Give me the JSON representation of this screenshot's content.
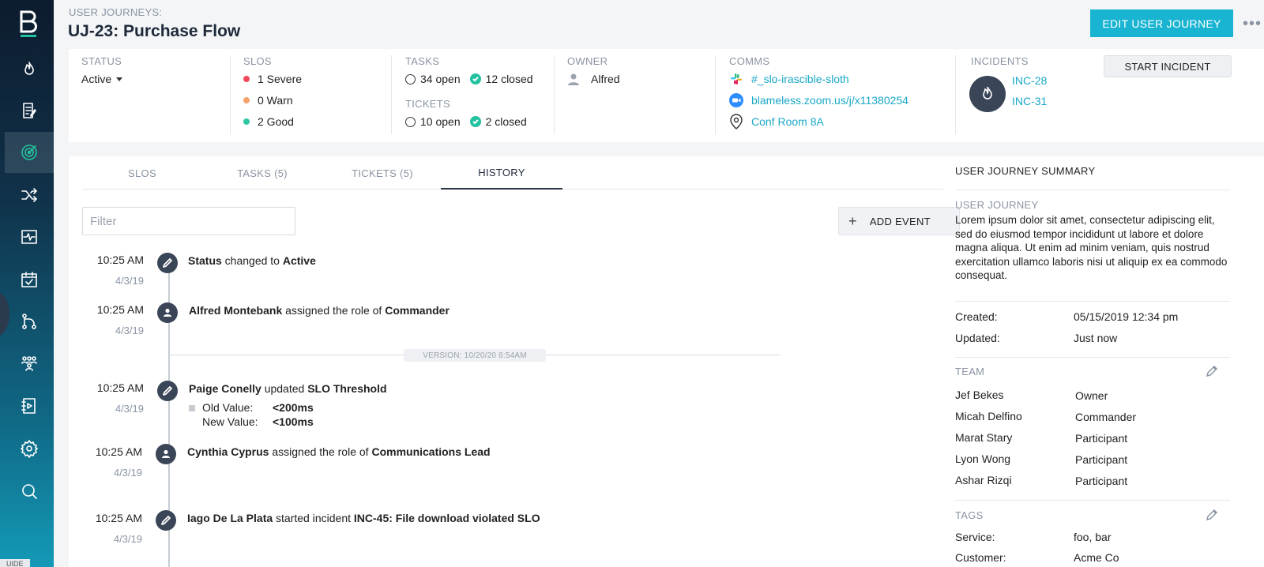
{
  "sidebar": {
    "logo": "B",
    "items": [
      {
        "icon": "flame-icon"
      },
      {
        "icon": "document-edit-icon"
      },
      {
        "icon": "target-icon",
        "active": true
      },
      {
        "icon": "shuffle-icon"
      },
      {
        "icon": "pulse-icon"
      },
      {
        "icon": "calendar-check-icon"
      },
      {
        "icon": "git-branch-icon"
      },
      {
        "icon": "team-icon"
      },
      {
        "icon": "playbook-icon"
      },
      {
        "icon": "gear-icon"
      },
      {
        "icon": "search-icon"
      }
    ],
    "bottom_tag": "UIDE"
  },
  "header": {
    "breadcrumb": "USER JOURNEYS:",
    "title": "UJ-23: Purchase Flow",
    "edit_button": "EDIT USER JOURNEY",
    "more": "•••"
  },
  "info": {
    "status": {
      "label": "STATUS",
      "value": "Active"
    },
    "slos": {
      "label": "SLOS",
      "items": [
        {
          "text": "1 Severe",
          "color": "#ee4a5a"
        },
        {
          "text": "0 Warn",
          "color": "#f5a26b"
        },
        {
          "text": "2 Good",
          "color": "#2ec5a2"
        }
      ]
    },
    "tasks": {
      "label": "TASKS",
      "open": "34 open",
      "closed": "12 closed"
    },
    "tickets": {
      "label": "TICKETS",
      "open": "10 open",
      "closed": "2 closed"
    },
    "owner": {
      "label": "OWNER",
      "name": "Alfred"
    },
    "comms": {
      "label": "COMMS",
      "slack": "#_slo-irascible-sloth",
      "zoom": "blameless.zoom.us/j/x11380254",
      "room": "Conf Room 8A"
    },
    "incidents": {
      "label": "INCIDENTS",
      "items": [
        "INC-28",
        "INC-31"
      ],
      "start_button": "START INCIDENT"
    }
  },
  "tabs": [
    {
      "label": "SLOS"
    },
    {
      "label": "TASKS (5)"
    },
    {
      "label": "TICKETS (5)"
    },
    {
      "label": "HISTORY",
      "active": true
    }
  ],
  "filter": {
    "placeholder": "Filter"
  },
  "add_event": "ADD EVENT",
  "version": "VERSION: 10/20/20 8:54AM",
  "events": [
    {
      "time": "10:25 AM",
      "date": "4/3/19",
      "actor": "Status",
      "verb": " changed to ",
      "object": "Active"
    },
    {
      "time": "10:25 AM",
      "date": "4/3/19",
      "actor": "Alfred Montebank",
      "verb": " assigned the role of ",
      "object": "Commander"
    },
    {
      "time": "10:25 AM",
      "date": "4/3/19",
      "actor": "Paige Conelly",
      "verb": " updated ",
      "object": "SLO Threshold",
      "old_label": "Old Value:",
      "old_value": "<200ms",
      "new_label": "New Value:",
      "new_value": "<100ms"
    },
    {
      "time": "10:25 AM",
      "date": "4/3/19",
      "actor": "Cynthia Cyprus",
      "verb": " assigned the role of ",
      "object": "Communications Lead"
    },
    {
      "time": "10:25 AM",
      "date": "4/3/19",
      "actor": "Iago De La Plata",
      "verb": " started incident ",
      "object": "INC-45: File download violated SLO"
    }
  ],
  "summary": {
    "title": "USER JOURNEY SUMMARY",
    "journey_label": "USER JOURNEY",
    "description": "Lorem ipsum dolor sit amet, consectetur adipiscing elit, sed do eiusmod tempor incididunt ut labore et dolore magna aliqua. Ut enim ad minim veniam, quis nostrud exercitation ullamco laboris nisi ut aliquip ex ea commodo consequat.",
    "created_label": "Created:",
    "created_value": "05/15/2019 12:34 pm",
    "updated_label": "Updated:",
    "updated_value": "Just now",
    "team_label": "TEAM",
    "team": [
      {
        "name": "Jef Bekes",
        "role": "Owner"
      },
      {
        "name": "Micah Delfino",
        "role": "Commander"
      },
      {
        "name": "Marat Stary",
        "role": "Participant"
      },
      {
        "name": "Lyon Wong",
        "role": "Participant"
      },
      {
        "name": "Ashar Rizqi",
        "role": "Participant"
      }
    ],
    "tags_label": "TAGS",
    "service_label": "Service:",
    "service_value": "foo, bar",
    "customer_label": "Customer:",
    "customer_value": "Acme Co"
  }
}
